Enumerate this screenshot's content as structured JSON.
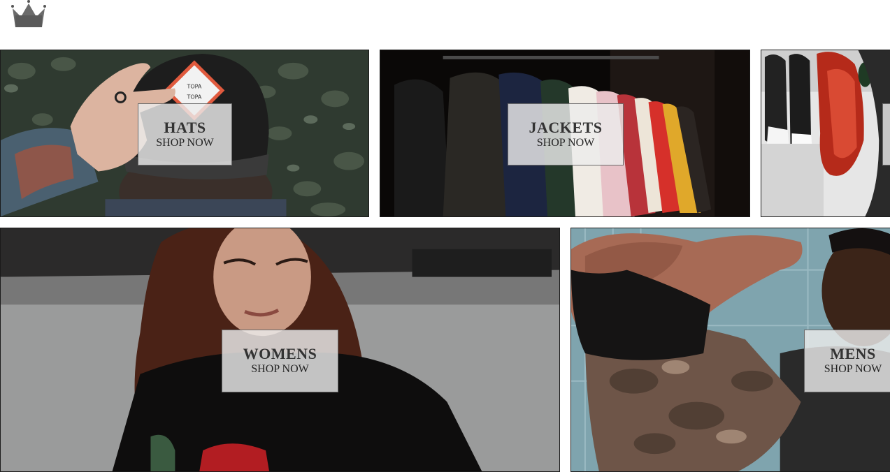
{
  "brand": {
    "logo_icon": "crown-icon"
  },
  "categories": [
    {
      "title": "HATS",
      "cta": "SHOP NOW"
    },
    {
      "title": "JACKETS",
      "cta": "SHOP NOW"
    },
    {
      "title": "",
      "cta": ""
    },
    {
      "title": "WOMENS",
      "cta": "SHOP NOW"
    },
    {
      "title": "MENS",
      "cta": "SHOP NOW"
    }
  ]
}
